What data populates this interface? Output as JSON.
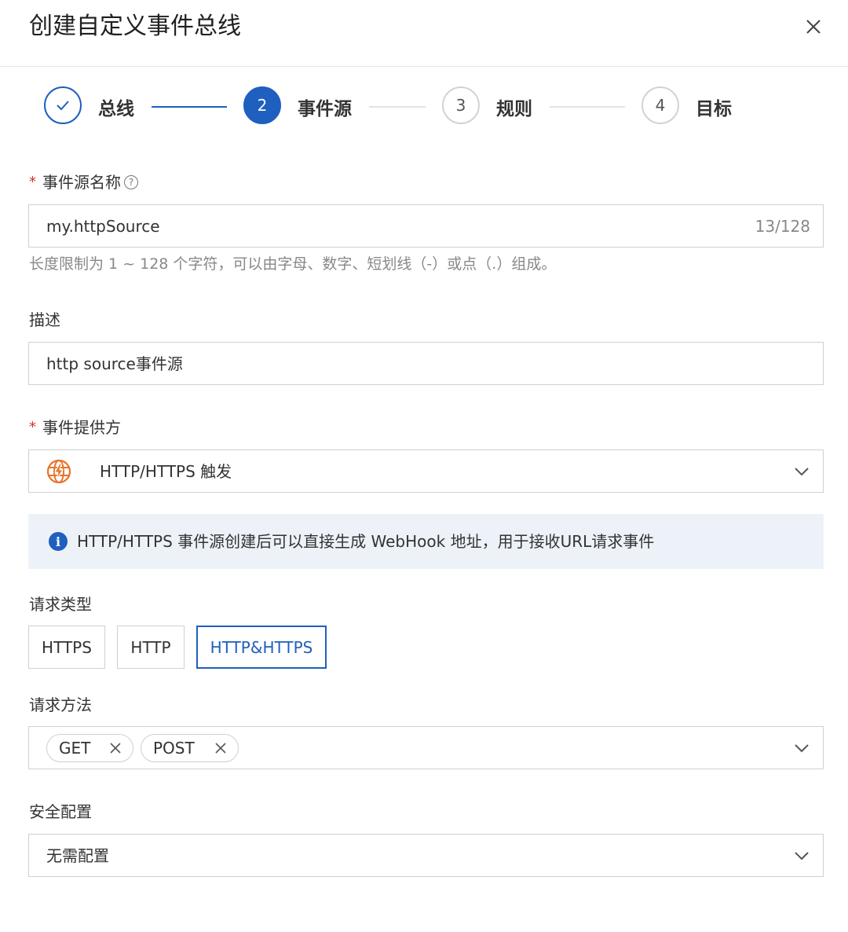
{
  "dialog": {
    "title": "创建自定义事件总线"
  },
  "steps": [
    {
      "number": "",
      "label": "总线",
      "state": "done"
    },
    {
      "number": "2",
      "label": "事件源",
      "state": "active"
    },
    {
      "number": "3",
      "label": "规则",
      "state": "pending"
    },
    {
      "number": "4",
      "label": "目标",
      "state": "pending"
    }
  ],
  "form": {
    "source_name": {
      "required_mark": "*",
      "label": "事件源名称",
      "help_icon": "?",
      "value": "my.httpSource",
      "counter": "13/128",
      "hint": "长度限制为 1 ~ 128 个字符，可以由字母、数字、短划线（-）或点（.）组成。"
    },
    "description": {
      "label": "描述",
      "value": "http source事件源"
    },
    "provider": {
      "required_mark": "*",
      "label": "事件提供方",
      "value": "HTTP/HTTPS 触发",
      "icon": "globe-lightning-icon"
    },
    "notice": {
      "icon": "i",
      "text": "HTTP/HTTPS 事件源创建后可以直接生成 WebHook 地址，用于接收URL请求事件"
    },
    "request_type": {
      "label": "请求类型",
      "options": [
        "HTTPS",
        "HTTP",
        "HTTP&HTTPS"
      ],
      "selected": "HTTP&HTTPS"
    },
    "request_method": {
      "label": "请求方法",
      "tags": [
        "GET",
        "POST"
      ]
    },
    "security": {
      "label": "安全配置",
      "value": "无需配置"
    }
  },
  "colors": {
    "primary": "#1f5fbf",
    "required": "#d93026",
    "provider_icon": "#e8732a",
    "notice_bg": "#edf2f8"
  }
}
